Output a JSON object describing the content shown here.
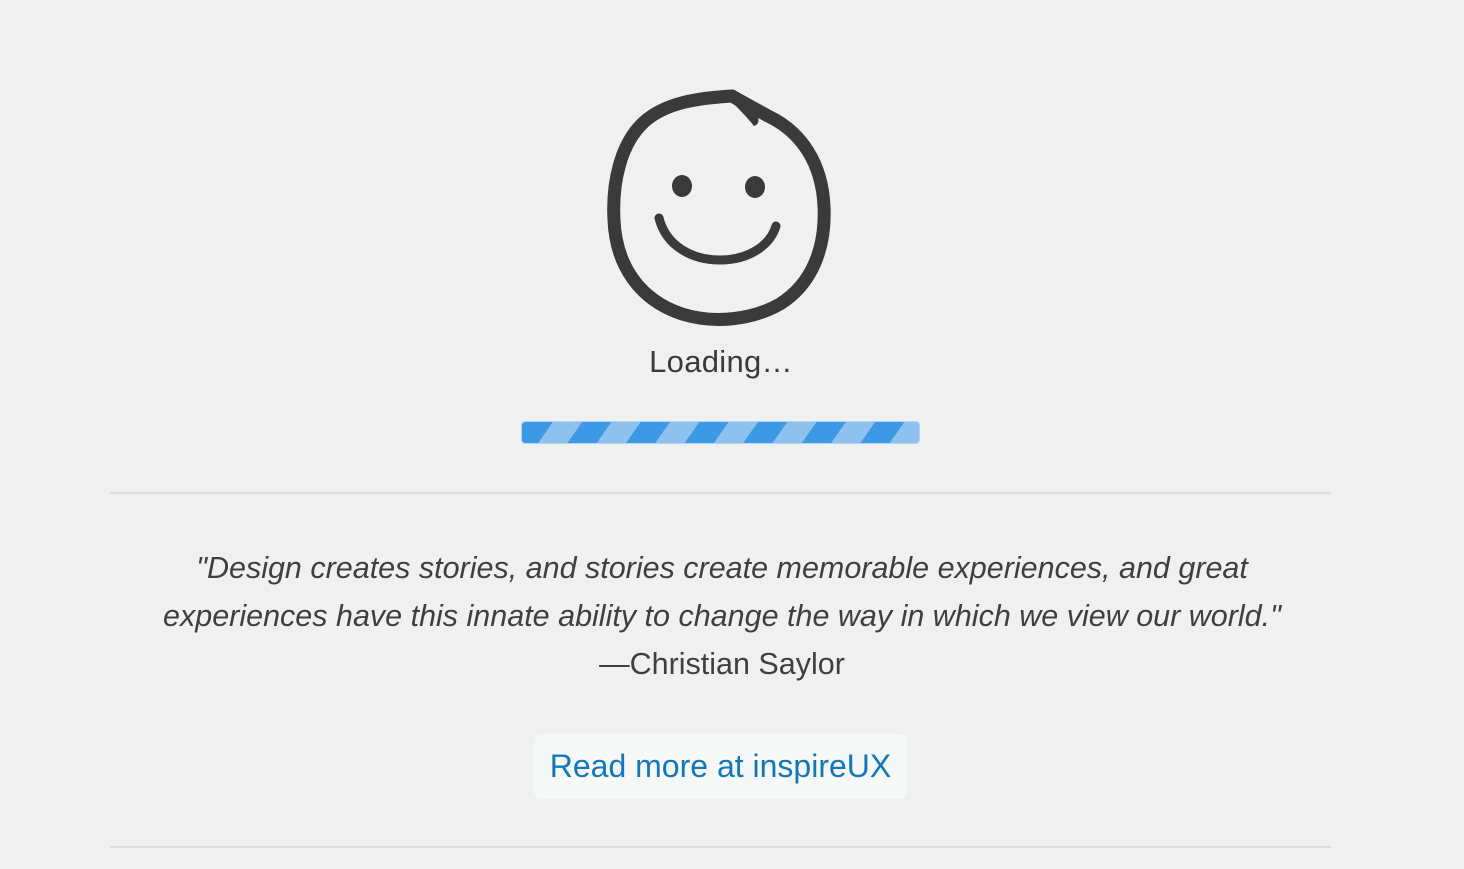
{
  "loader": {
    "logo_icon": "smiley-face-icon",
    "status_text": "Loading…",
    "progress_icon": "striped-progress-bar",
    "progress_percent": 100,
    "progress_colors": {
      "dark_stripe": "#3d99e4",
      "light_stripe": "#8dc1ef"
    }
  },
  "quote": {
    "text": "\"Design creates stories, and stories create memorable experiences, and great experiences have this innate ability to change the way in which we view our world.\"",
    "author": "—Christian Saylor"
  },
  "link": {
    "label": "Read more at inspireUX",
    "color": "#1478b8"
  },
  "colors": {
    "background": "#f0f0f0",
    "text": "#3b3b3b",
    "divider": "#dcdcdc"
  }
}
